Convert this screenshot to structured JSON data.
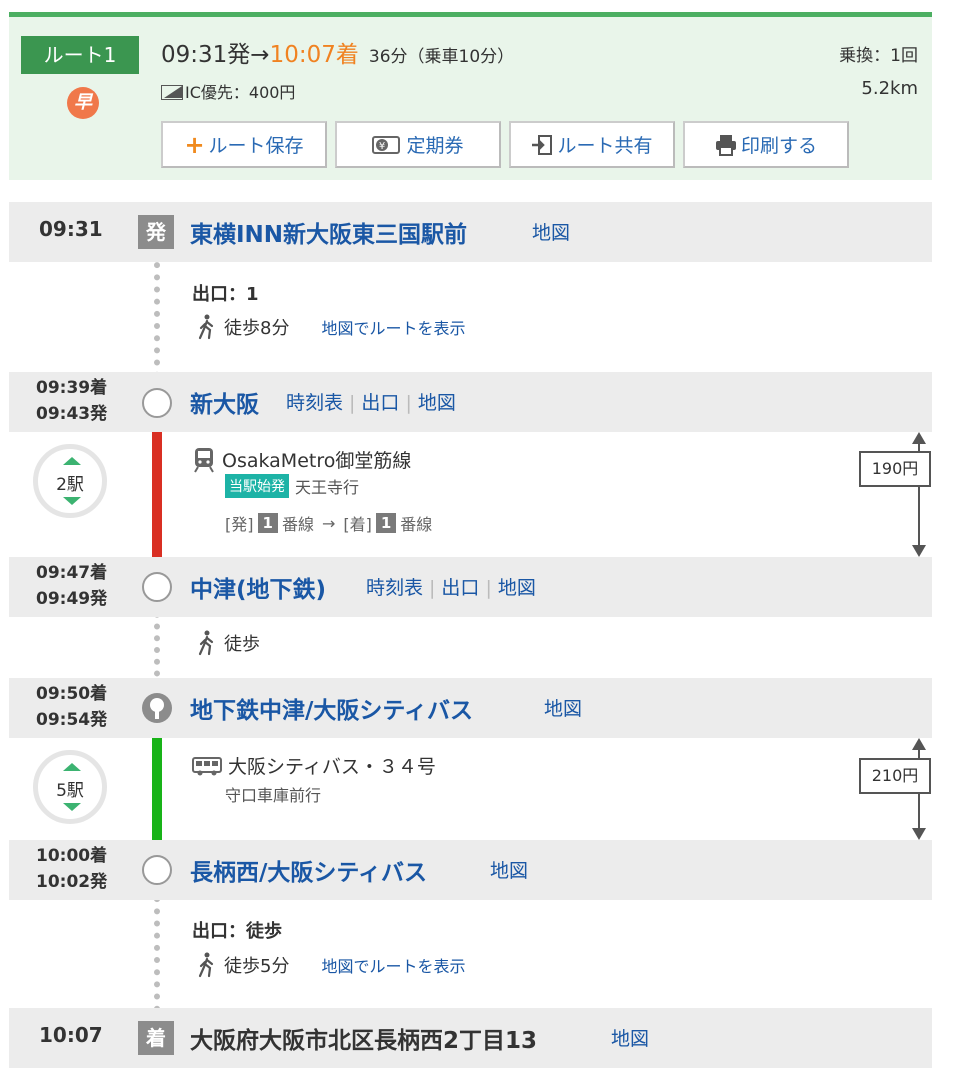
{
  "summary": {
    "route_label": "ルート1",
    "haya_icon": "早",
    "dep_time": "09:31発",
    "arrow": "→",
    "arr_time": "10:07着",
    "duration": "36分（乗車10分）",
    "ic_label": "IC優先：400円",
    "transfer": "乗換：1回",
    "distance": "5.2km",
    "buttons": {
      "save": "ルート保存",
      "pass": "定期券",
      "share": "ルート共有",
      "print": "印刷する"
    }
  },
  "colors": {
    "accent_green": "#4caf62",
    "badge_green": "#3b9650",
    "link_blue": "#1a57a5",
    "metro_red": "#d92f23",
    "bus_green": "#18b318",
    "arrival_orange": "#f08221"
  },
  "stations": {
    "s1": {
      "time": "09:31",
      "mark": "発",
      "name": "東横INN新大阪東三国駅前",
      "map": "地図"
    },
    "s2": {
      "arr": "09:39着",
      "dep": "09:43発",
      "name": "新大阪",
      "timetable": "時刻表",
      "exit": "出口",
      "map": "地図"
    },
    "s3": {
      "arr": "09:47着",
      "dep": "09:49発",
      "name": "中津(地下鉄)",
      "timetable": "時刻表",
      "exit": "出口",
      "map": "地図"
    },
    "s4": {
      "arr": "09:50着",
      "dep": "09:54発",
      "name": "地下鉄中津/大阪シティバス",
      "map": "地図"
    },
    "s5": {
      "arr": "10:00着",
      "dep": "10:02発",
      "name": "長柄西/大阪シティバス",
      "map": "地図"
    },
    "s6": {
      "time": "10:07",
      "mark": "着",
      "name": "大阪府大阪市北区長柄西2丁目13",
      "map": "地図"
    }
  },
  "segments": {
    "walk1": {
      "exit": "出口：1",
      "walk": "徒歩8分",
      "maplink": "地図でルートを表示"
    },
    "metro": {
      "stops": "2駅",
      "line": "OsakaMetro御堂筋線",
      "tag": "当駅始発",
      "dest": "天王寺行",
      "dep_label": "[発]",
      "dep_plat": "1",
      "plat_suffix": "番線",
      "arrow": "→",
      "arr_label": "[着]",
      "arr_plat": "1",
      "fare": "190円"
    },
    "walk2": {
      "walk": "徒歩"
    },
    "bus": {
      "stops": "5駅",
      "line": "大阪シティバス・３４号",
      "dest": "守口車庫前行",
      "fare": "210円"
    },
    "walk3": {
      "exit": "出口：徒歩",
      "walk": "徒歩5分",
      "maplink": "地図でルートを表示"
    }
  }
}
